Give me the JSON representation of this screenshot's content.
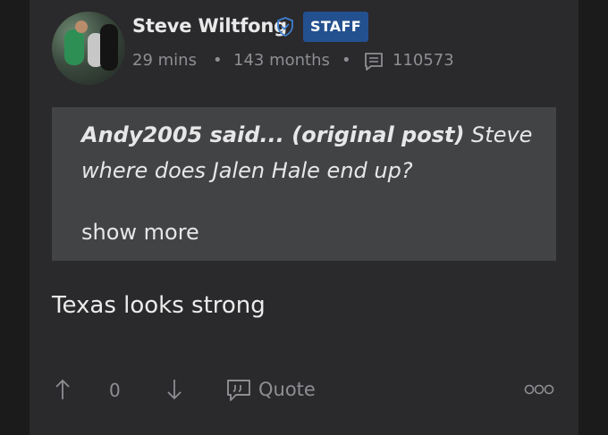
{
  "post": {
    "author": "Steve Wiltfong",
    "badge": "STAFF",
    "time_ago": "29 mins",
    "membership": "143 months",
    "separator": "•",
    "post_count": "110573",
    "quote": {
      "author_line": "Andy2005 said... (original post)",
      "text": " Steve where does Jalen Hale end up?",
      "show_more": "show more"
    },
    "body": "Texas looks strong",
    "votes": "0",
    "quote_label": "Quote"
  },
  "colors": {
    "badge_bg": "#23508f",
    "card_bg": "#2a292b",
    "quote_bg": "#424345",
    "muted": "#8d8f93"
  },
  "icons": [
    "verified-shield-icon",
    "comment-icon",
    "upvote-arrow-icon",
    "downvote-arrow-icon",
    "quote-bubble-icon",
    "more-options-icon"
  ]
}
